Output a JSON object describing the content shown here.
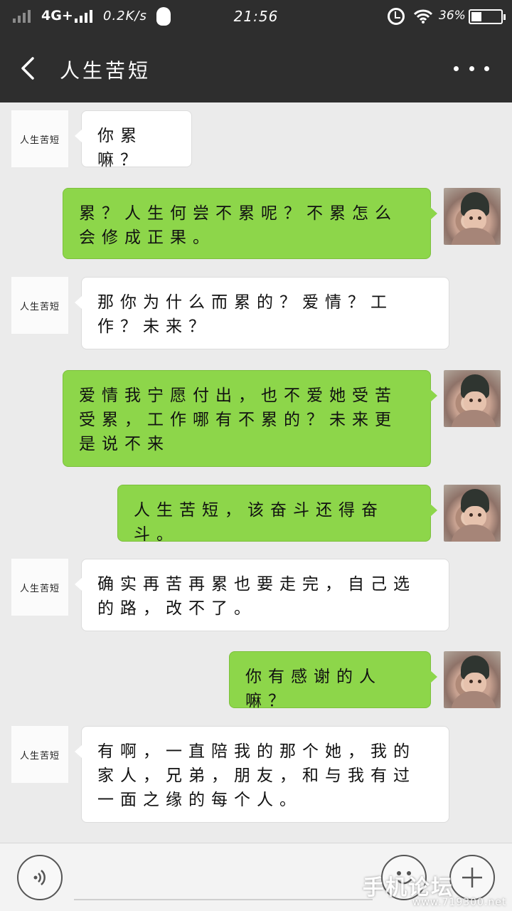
{
  "status_bar": {
    "network": "4G+",
    "speed": "0.2K/s",
    "time": "21:56",
    "battery_percent": "36%",
    "battery_level": 0.36
  },
  "header": {
    "back_icon": "chevron-left-icon",
    "title": "人生苦短",
    "more_icon": "more-dots-icon"
  },
  "friend": {
    "avatar_text": "人生苦短"
  },
  "messages": [
    {
      "from": "friend",
      "text": "你累嘛？"
    },
    {
      "from": "me",
      "text": "累？人生何尝不累呢？不累怎么会修成正果。"
    },
    {
      "from": "friend",
      "text": "那你为什么而累的？爱情？工作？未来？"
    },
    {
      "from": "me",
      "text": "爱情我宁愿付出，也不爱她受苦受累，工作哪有不累的？未来更是说不来"
    },
    {
      "from": "me",
      "text": "人生苦短，该奋斗还得奋斗。"
    },
    {
      "from": "friend",
      "text": "确实再苦再累也要走完，自己选的路，改不了。"
    },
    {
      "from": "me",
      "text": "你有感谢的人嘛？"
    },
    {
      "from": "friend",
      "text": "有啊，一直陪我的那个她，我的家人，兄弟，朋友，和与我有过一面之缘的每个人。"
    }
  ],
  "input_bar": {
    "voice_icon": "voice-icon",
    "emoji_icon": "emoji-icon",
    "add_icon": "plus-icon"
  },
  "watermark": {
    "text": "手机论坛",
    "url": "www.719300.net"
  }
}
